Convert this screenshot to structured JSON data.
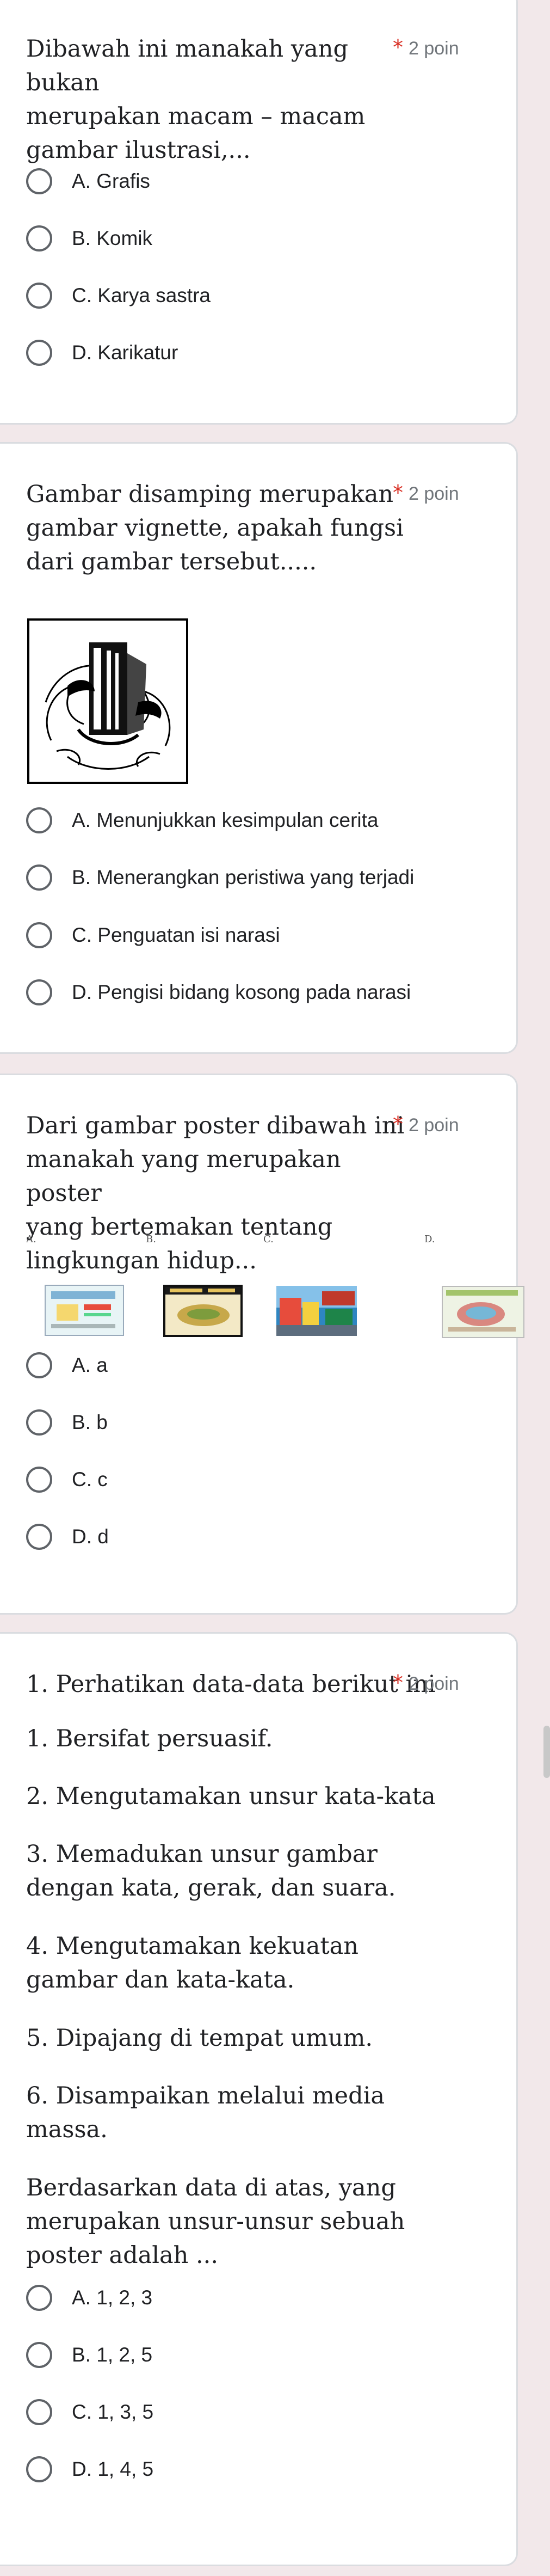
{
  "q1": {
    "text": "Dibawah ini manakah yang bukan\nmerupakan macam – macam\ngambar ilustrasi,...",
    "required_mark": "*",
    "points": "2 poin",
    "options": [
      "A. Grafis",
      "B. Komik",
      "C. Karya sastra",
      "D. Karikatur"
    ]
  },
  "q2": {
    "text": "Gambar disamping merupakan\ngambar vignette, apakah fungsi\ndari gambar tersebut.....",
    "required_mark": "*",
    "points": "2 poin",
    "options": [
      "A. Menunjukkan kesimpulan cerita",
      "B. Menerangkan peristiwa yang terjadi",
      "C. Penguatan isi narasi",
      "D. Pengisi bidang kosong pada narasi"
    ]
  },
  "q3": {
    "text": "Dari gambar poster dibawah ini\nmanakah yang merupakan poster\nyang bertemakan tentang\nlingkungan hidup...",
    "required_mark": "*",
    "points": "2 poin",
    "poster_labels": [
      "A.",
      "B.",
      "C.",
      "D."
    ],
    "options": [
      "A. a",
      "B. b",
      "C. c",
      "D. d"
    ]
  },
  "q4": {
    "text": "1. Perhatikan data-data berikut ini",
    "required_mark": "*",
    "points": "2 poin",
    "items": [
      "1. Bersifat persuasif.",
      "2. Mengutamakan unsur kata-kata",
      "3. Memadukan unsur gambar\ndengan kata, gerak, dan suara.",
      "4. Mengutamakan kekuatan\ngambar dan kata-kata.",
      "5. Dipajang di tempat umum.",
      "6. Disampaikan melalui media\nmassa."
    ],
    "question": "Berdasarkan data di atas, yang\nmerupakan unsur-unsur sebuah\nposter adalah ...",
    "options": [
      "A. 1, 2, 3",
      "B. 1, 2, 5",
      "C. 1, 3, 5",
      "D. 1, 4, 5"
    ]
  }
}
